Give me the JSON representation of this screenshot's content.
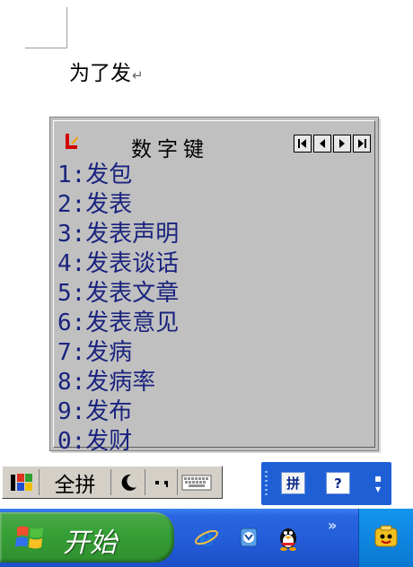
{
  "document": {
    "text": "为了发",
    "paragraph_mark": "↵"
  },
  "candidate_window": {
    "mode_label": "数字键",
    "nav_buttons": [
      "first",
      "previous",
      "next",
      "last"
    ],
    "items": [
      "1:发包",
      "2:发表",
      "3:发表声明",
      "4:发表谈话",
      "5:发表文章",
      "6:发表意见",
      "7:发病",
      "8:发病率",
      "9:发布",
      "0:发财"
    ]
  },
  "ime_status_bar": {
    "input_mode": "全拼",
    "icons": [
      "windows-flag-icon",
      "half-moon-icon",
      "punctuation-icon",
      "soft-keyboard-icon"
    ]
  },
  "language_bar": {
    "ime_button": "拼",
    "help_button": "?"
  },
  "taskbar": {
    "start_label": "开始",
    "quick_launch": [
      "internet-explorer-icon",
      "outlook-express-icon",
      "qq-penguin-icon"
    ],
    "overflow": "»",
    "tray": [
      "qq-messenger-icon"
    ]
  },
  "colors": {
    "candidate_text": "#1a237e",
    "taskbar_blue": "#245edb",
    "start_green": "#36a036",
    "tray_blue": "#0f86e0",
    "panel_gray": "#c0c0c0"
  }
}
